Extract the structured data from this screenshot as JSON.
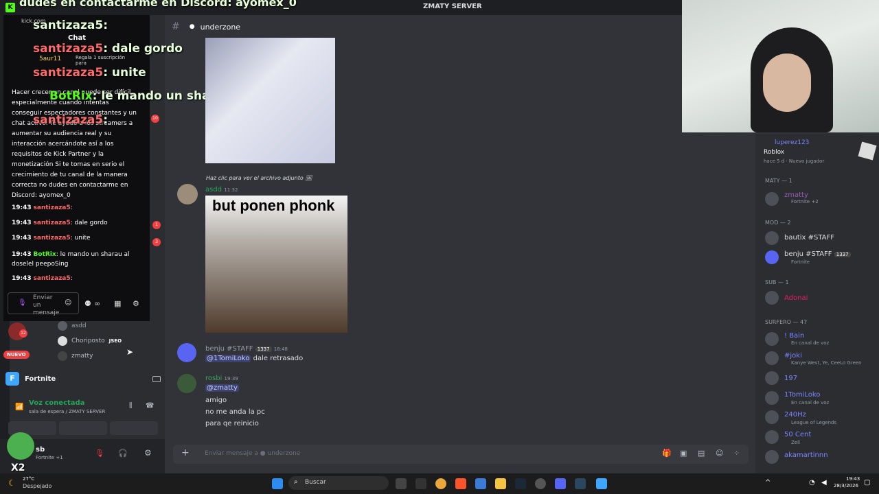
{
  "window": {
    "title": "ZMATY SERVER"
  },
  "overlay": {
    "top_text": "dudes en contactarme en Discord: ayomex_0",
    "lines": [
      {
        "user": "santizaza5",
        "text": ":"
      },
      {
        "user": "santizaza5",
        "text": ": dale gordo"
      },
      {
        "user": "santizaza5",
        "text": ": unite"
      },
      {
        "user": "BotRix",
        "text": ": le mando un sharau al"
      },
      {
        "user": "santizaza5",
        "text": ":"
      }
    ]
  },
  "kick": {
    "url": "kick.com",
    "tab": "Chat",
    "sub_user": "5aur11",
    "sub_text": "Regala 1 suscripción para",
    "promo": "Hacer crecer un canal puede ser difícil, especialmente cuando intentas conseguir espectadores constantes y un chat activo. Te ayudo a los streamers a aumentar su audiencia real y su interacción acercándote así a los requisitos de Kick Partner y la monetización Si te tomas en serio el crecimiento de tu canal de la manera correcta no dudes en contactarme en Discord: ayomex_0",
    "messages": [
      {
        "time": "19:43",
        "user": "santizaza5",
        "text": ":"
      },
      {
        "time": "19:43",
        "user": "santizaza5",
        "text": ": dale gordo"
      },
      {
        "time": "19:43",
        "user": "santizaza5",
        "text": ": unite"
      },
      {
        "time": "19:43",
        "user": "BotRix",
        "text": ": le mando un sharau al doselel peepoSing"
      },
      {
        "time": "19:43",
        "user": "santizaza5",
        "text": ":"
      }
    ],
    "input_placeholder": "Enviar un mensaje"
  },
  "sidebar": {
    "voice_users": [
      {
        "name": "asdd"
      },
      {
        "name": "Choriposto",
        "tag": "JSEO"
      },
      {
        "name": "zmatty"
      }
    ],
    "new_badge": "NUEVO",
    "activity": "Fortnite",
    "voice_status": "Voz conectada",
    "voice_channel": "sala de espera / ZMATY SERVER",
    "user": {
      "name": "sb",
      "status": "Fortnite +1"
    },
    "badges": [
      "10",
      "1",
      "3",
      "12"
    ],
    "x2": "X2"
  },
  "channel": {
    "name": "underzone"
  },
  "messages": [
    {
      "reply": "Haz clic para ver el archivo adjunto",
      "author": "asdd",
      "time": "11:32",
      "image_caption": "but ponen phonk"
    },
    {
      "author": "benju #STAFF",
      "tag": "1337",
      "time": "18:48",
      "mention": "@1TomiLoko",
      "text": "dale retrasado"
    },
    {
      "author": "rosbi",
      "time": "19:39",
      "mention": "@zmatty",
      "lines": [
        "amigo",
        "no me anda la pc",
        "para qe reinicio"
      ]
    }
  ],
  "composer": {
    "placeholder": "Enviar mensaje a",
    "channel": "underzone"
  },
  "members": {
    "playing": {
      "name": "luperez123",
      "game": "Roblox",
      "meta": "hace 5 d",
      "badge": "Nuevo jugador"
    },
    "groups": [
      {
        "title": "MATY",
        "count": "— 1",
        "items": [
          {
            "name": "zmatty",
            "sub": "Fortnite +2"
          }
        ]
      },
      {
        "title": "MOD",
        "count": "— 2",
        "items": [
          {
            "name": "bautix #STAFF",
            "sub": ""
          },
          {
            "name": "benju #STAFF",
            "tag": "1337",
            "sub": "Fortnite"
          }
        ]
      },
      {
        "title": "SUB",
        "count": "— 1",
        "items": [
          {
            "name": "Adonai",
            "sub": ""
          }
        ]
      },
      {
        "title": "SURFERO",
        "count": "— 47",
        "items": [
          {
            "name": "! Bain",
            "sub": "En canal de voz"
          },
          {
            "name": "#joki",
            "sub": "Kanye West, Ye, CeeLo Green"
          },
          {
            "name": "197",
            "sub": ""
          },
          {
            "name": "1TomiLoko",
            "sub": "En canal de voz"
          },
          {
            "name": "240Hz",
            "sub": "League of Legends"
          },
          {
            "name": "50 Cent",
            "sub": "Zell"
          },
          {
            "name": "akamartinnn",
            "sub": ""
          }
        ]
      }
    ]
  },
  "taskbar": {
    "weather_temp": "27°C",
    "weather_text": "Despejado",
    "search": "Buscar",
    "time": "19:43",
    "date": "28/3/2026"
  },
  "colors": {
    "accent": "#5865f2",
    "kick": "#53fc18",
    "online": "#23a55a"
  }
}
